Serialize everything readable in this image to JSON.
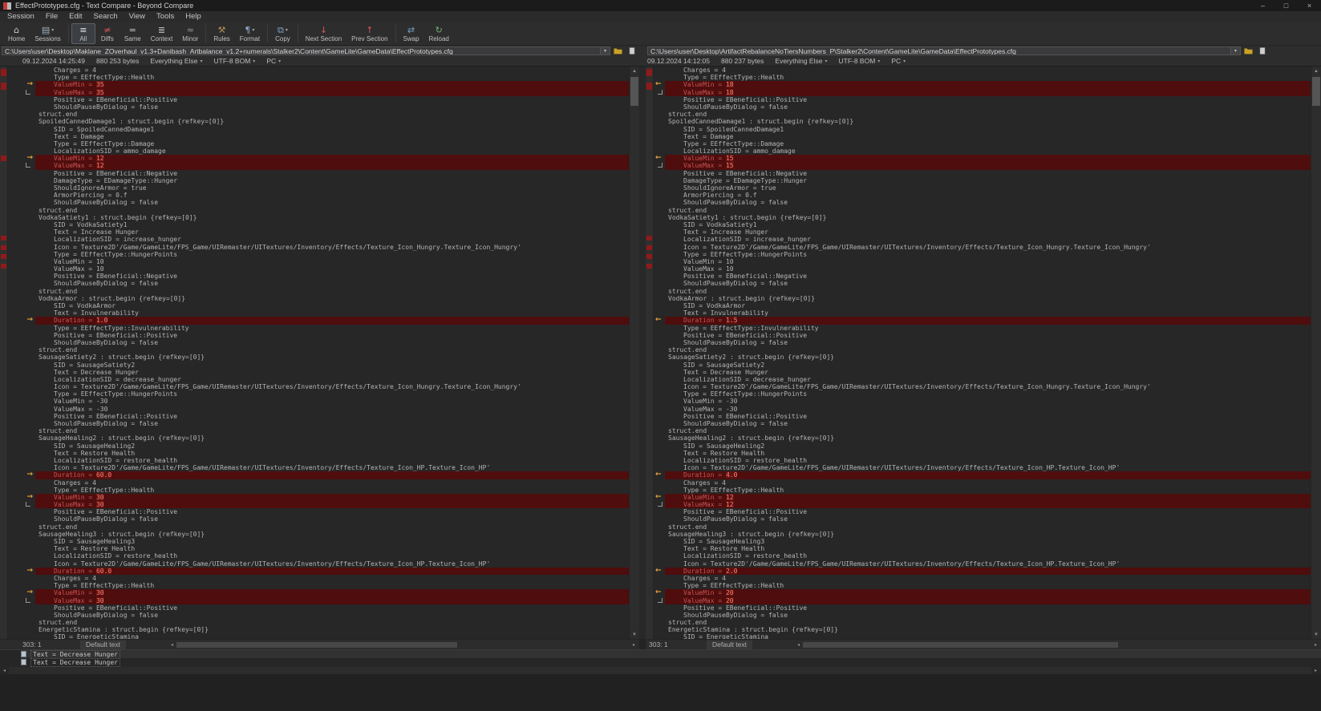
{
  "window": {
    "title": "EffectPrototypes.cfg - Text Compare - Beyond Compare",
    "minimize": "–",
    "maximize": "□",
    "close": "×"
  },
  "menu": {
    "items": [
      "Session",
      "File",
      "Edit",
      "Search",
      "View",
      "Tools",
      "Help"
    ]
  },
  "icons": {
    "dropdown": "▾",
    "up": "▲",
    "down": "▼",
    "left": "◂",
    "right": "▸",
    "diff_arrow_right": "→",
    "diff_arrow_left": "←"
  },
  "toolbar": {
    "items": [
      {
        "name": "home",
        "label": "Home",
        "glyph": "⌂",
        "color": "#c8c8c8",
        "dropdown": false,
        "active": false,
        "sep_after": false
      },
      {
        "name": "sessions",
        "label": "Sessions",
        "glyph": "▤",
        "color": "#9fb2c0",
        "dropdown": true,
        "active": false,
        "sep_after": true
      },
      {
        "name": "all",
        "label": "All",
        "glyph": "≡",
        "color": "#e8e8e8",
        "dropdown": false,
        "active": true,
        "sep_after": false
      },
      {
        "name": "diffs",
        "label": "Diffs",
        "glyph": "≠",
        "color": "#d05555",
        "dropdown": false,
        "active": false,
        "sep_after": false
      },
      {
        "name": "same",
        "label": "Same",
        "glyph": "=",
        "color": "#c8c8c8",
        "dropdown": false,
        "active": false,
        "sep_after": false
      },
      {
        "name": "context",
        "label": "Context",
        "glyph": "≣",
        "color": "#c8c8c8",
        "dropdown": false,
        "active": false,
        "sep_after": false
      },
      {
        "name": "minor",
        "label": "Minor",
        "glyph": "≈",
        "color": "#999999",
        "dropdown": false,
        "active": false,
        "sep_after": true
      },
      {
        "name": "rules",
        "label": "Rules",
        "glyph": "⚒",
        "color": "#b08d57",
        "dropdown": false,
        "active": false,
        "sep_after": false
      },
      {
        "name": "format",
        "label": "Format",
        "glyph": "¶",
        "color": "#8fa8c8",
        "dropdown": true,
        "active": false,
        "sep_after": true
      },
      {
        "name": "copy",
        "label": "Copy",
        "glyph": "⧉",
        "color": "#7fa7c9",
        "dropdown": true,
        "active": false,
        "sep_after": true
      },
      {
        "name": "next-section",
        "label": "Next Section",
        "glyph": "↓",
        "color": "#d05555",
        "dropdown": false,
        "active": false,
        "sep_after": false
      },
      {
        "name": "prev-section",
        "label": "Prev Section",
        "glyph": "↑",
        "color": "#d05555",
        "dropdown": false,
        "active": false,
        "sep_after": true
      },
      {
        "name": "swap",
        "label": "Swap",
        "glyph": "⇄",
        "color": "#74a0c8",
        "dropdown": false,
        "active": false,
        "sep_after": false
      },
      {
        "name": "reload",
        "label": "Reload",
        "glyph": "↻",
        "color": "#74b06a",
        "dropdown": false,
        "active": false,
        "sep_after": false
      }
    ]
  },
  "left_pane": {
    "path": "C:\\Users\\user\\Desktop\\Maklane_ZOverhaul_v1.3+Danibash_Artbalance_v1.2+numerals\\Stalker2\\Content\\GameLite\\GameData\\EffectPrototypes.cfg",
    "modified": "09.12.2024 14:25:49",
    "size": "880 253 bytes",
    "grammar": "Everything Else",
    "encoding": "UTF-8 BOM",
    "line_format": "PC",
    "cursor": "303: 1",
    "status": "Default text",
    "overview_marks": [
      {
        "t": 0.004,
        "h": 9
      },
      {
        "t": 0.028,
        "h": 9
      },
      {
        "t": 0.155,
        "h": 7
      },
      {
        "t": 0.296,
        "h": 6
      },
      {
        "t": 0.312,
        "h": 6
      },
      {
        "t": 0.328,
        "h": 6
      },
      {
        "t": 0.344,
        "h": 6
      }
    ]
  },
  "right_pane": {
    "path": "C:\\Users\\user\\Desktop\\ArtifactRebalanceNoTiersNumbers_P\\Stalker2\\Content\\GameLite\\GameData\\EffectPrototypes.cfg",
    "modified": "09.12.2024 14:12:05",
    "size": "880 237 bytes",
    "grammar": "Everything Else",
    "encoding": "UTF-8 BOM",
    "line_format": "PC",
    "cursor": "303: 1",
    "status": "Default text",
    "overview_marks": [
      {
        "t": 0.004,
        "h": 9
      },
      {
        "t": 0.028,
        "h": 9
      },
      {
        "t": 0.296,
        "h": 6
      },
      {
        "t": 0.312,
        "h": 6
      },
      {
        "t": 0.328,
        "h": 6
      },
      {
        "t": 0.344,
        "h": 6
      }
    ]
  },
  "code": {
    "lines": [
      {
        "in": 1,
        "t": "Charges = 4"
      },
      {
        "in": 1,
        "t": "Type = EEffectType::Health"
      },
      {
        "in": 1,
        "l": "ValueMin = 35",
        "r": "ValueMin = 18",
        "mk": "a"
      },
      {
        "in": 1,
        "l": "ValueMax = 35",
        "r": "ValueMax = 18",
        "mk": "b"
      },
      {
        "in": 1,
        "t": "Positive = EBeneficial::Positive"
      },
      {
        "in": 1,
        "t": "ShouldPauseByDialog = false"
      },
      {
        "in": 0,
        "t": "struct.end"
      },
      {
        "in": 0,
        "t": "SpoiledCannedDamage1 : struct.begin {refkey=[0]}"
      },
      {
        "in": 1,
        "t": "SID = SpoiledCannedDamage1"
      },
      {
        "in": 1,
        "t": "Text = Damage"
      },
      {
        "in": 1,
        "t": "Type = EEffectType::Damage"
      },
      {
        "in": 1,
        "t": "LocalizationSID = ammo_damage"
      },
      {
        "in": 1,
        "l": "ValueMin = 12",
        "r": "ValueMin = 15",
        "mk": "a"
      },
      {
        "in": 1,
        "l": "ValueMax = 12",
        "r": "ValueMax = 15",
        "mk": "b"
      },
      {
        "in": 1,
        "t": "Positive = EBeneficial::Negative"
      },
      {
        "in": 1,
        "t": "DamageType = EDamageType::Hunger"
      },
      {
        "in": 1,
        "t": "ShouldIgnoreArmor = true"
      },
      {
        "in": 1,
        "t": "ArmorPiercing = 0.f"
      },
      {
        "in": 1,
        "t": "ShouldPauseByDialog = false"
      },
      {
        "in": 0,
        "t": "struct.end"
      },
      {
        "in": 0,
        "t": "VodkaSatiety1 : struct.begin {refkey=[0]}"
      },
      {
        "in": 1,
        "t": "SID = VodkaSatiety1"
      },
      {
        "in": 1,
        "t": "Text = Increase Hunger"
      },
      {
        "in": 1,
        "t": "LocalizationSID = increase_hunger"
      },
      {
        "in": 1,
        "t": "Icon = Texture2D'/Game/GameLite/FPS_Game/UIRemaster/UITextures/Inventory/Effects/Texture_Icon_Hungry.Texture_Icon_Hungry'"
      },
      {
        "in": 1,
        "t": "Type = EEffectType::HungerPoints"
      },
      {
        "in": 1,
        "t": "ValueMin = 10"
      },
      {
        "in": 1,
        "t": "ValueMax = 10"
      },
      {
        "in": 1,
        "t": "Positive = EBeneficial::Negative"
      },
      {
        "in": 1,
        "t": "ShouldPauseByDialog = false"
      },
      {
        "in": 0,
        "t": "struct.end"
      },
      {
        "in": 0,
        "t": "VodkaArmor : struct.begin {refkey=[0]}"
      },
      {
        "in": 1,
        "t": "SID = VodkaArmor"
      },
      {
        "in": 1,
        "t": "Text = Invulnerability"
      },
      {
        "in": 1,
        "l": "Duration = 1.0",
        "r": "Duration = 1.5",
        "mk": "a"
      },
      {
        "in": 1,
        "t": "Type = EEffectType::Invulnerability"
      },
      {
        "in": 1,
        "t": "Positive = EBeneficial::Positive"
      },
      {
        "in": 1,
        "t": "ShouldPauseByDialog = false"
      },
      {
        "in": 0,
        "t": "struct.end"
      },
      {
        "in": 0,
        "t": "SausageSatiety2 : struct.begin {refkey=[0]}"
      },
      {
        "in": 1,
        "t": "SID = SausageSatiety2"
      },
      {
        "in": 1,
        "t": "Text = Decrease Hunger"
      },
      {
        "in": 1,
        "t": "LocalizationSID = decrease_hunger"
      },
      {
        "in": 1,
        "t": "Icon = Texture2D'/Game/GameLite/FPS_Game/UIRemaster/UITextures/Inventory/Effects/Texture_Icon_Hungry.Texture_Icon_Hungry'"
      },
      {
        "in": 1,
        "t": "Type = EEffectType::HungerPoints"
      },
      {
        "in": 1,
        "t": "ValueMin = -30"
      },
      {
        "in": 1,
        "t": "ValueMax = -30"
      },
      {
        "in": 1,
        "t": "Positive = EBeneficial::Positive"
      },
      {
        "in": 1,
        "t": "ShouldPauseByDialog = false"
      },
      {
        "in": 0,
        "t": "struct.end"
      },
      {
        "in": 0,
        "t": "SausageHealing2 : struct.begin {refkey=[0]}"
      },
      {
        "in": 1,
        "t": "SID = SausageHealing2"
      },
      {
        "in": 1,
        "t": "Text = Restore Health"
      },
      {
        "in": 1,
        "t": "LocalizationSID = restore_health"
      },
      {
        "in": 1,
        "t": "Icon = Texture2D'/Game/GameLite/FPS_Game/UIRemaster/UITextures/Inventory/Effects/Texture_Icon_HP.Texture_Icon_HP'"
      },
      {
        "in": 1,
        "l": "Duration = 60.0",
        "r": "Duration = 4.0",
        "mk": "a"
      },
      {
        "in": 1,
        "t": "Charges = 4"
      },
      {
        "in": 1,
        "t": "Type = EEffectType::Health"
      },
      {
        "in": 1,
        "l": "ValueMin = 30",
        "r": "ValueMin = 12",
        "mk": "a"
      },
      {
        "in": 1,
        "l": "ValueMax = 30",
        "r": "ValueMax = 12",
        "mk": "b"
      },
      {
        "in": 1,
        "t": "Positive = EBeneficial::Positive"
      },
      {
        "in": 1,
        "t": "ShouldPauseByDialog = false"
      },
      {
        "in": 0,
        "t": "struct.end"
      },
      {
        "in": 0,
        "t": "SausageHealing3 : struct.begin {refkey=[0]}"
      },
      {
        "in": 1,
        "t": "SID = SausageHealing3"
      },
      {
        "in": 1,
        "t": "Text = Restore Health"
      },
      {
        "in": 1,
        "t": "LocalizationSID = restore_health"
      },
      {
        "in": 1,
        "t": "Icon = Texture2D'/Game/GameLite/FPS_Game/UIRemaster/UITextures/Inventory/Effects/Texture_Icon_HP.Texture_Icon_HP'"
      },
      {
        "in": 1,
        "l": "Duration = 60.0",
        "r": "Duration = 2.0",
        "mk": "a"
      },
      {
        "in": 1,
        "t": "Charges = 4"
      },
      {
        "in": 1,
        "t": "Type = EEffectType::Health"
      },
      {
        "in": 1,
        "l": "ValueMin = 30",
        "r": "ValueMin = 20",
        "mk": "a"
      },
      {
        "in": 1,
        "l": "ValueMax = 30",
        "r": "ValueMax = 20",
        "mk": "b"
      },
      {
        "in": 1,
        "t": "Positive = EBeneficial::Positive"
      },
      {
        "in": 1,
        "t": "ShouldPauseByDialog = false"
      },
      {
        "in": 0,
        "t": "struct.end"
      },
      {
        "in": 0,
        "t": "EnergeticStamina : struct.begin {refkey=[0]}"
      },
      {
        "in": 1,
        "t": "SID = EnergeticStamina"
      }
    ]
  },
  "detail_panel": {
    "rows": [
      {
        "text": "Text = Decrease Hunger"
      },
      {
        "text": "Text = Decrease Hunger"
      }
    ]
  }
}
